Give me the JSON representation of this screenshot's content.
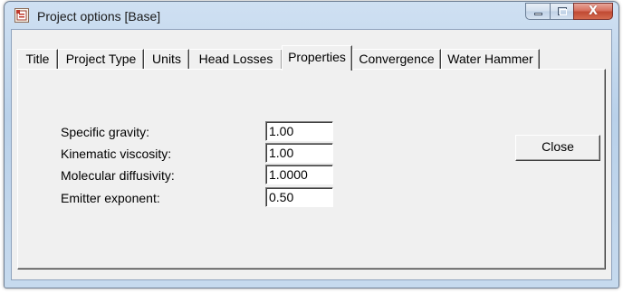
{
  "window": {
    "title": "Project options [Base]",
    "icon": "project-options-app-icon",
    "caption_buttons": {
      "minimize_icon": "minimize-icon",
      "maximize_icon": "maximize-icon",
      "close_glyph": "X"
    }
  },
  "tabs": [
    {
      "label": "Title"
    },
    {
      "label": "Project Type"
    },
    {
      "label": "Units"
    },
    {
      "label": "Head Losses"
    },
    {
      "label": "Properties",
      "active": true
    },
    {
      "label": "Convergence"
    },
    {
      "label": "Water Hammer"
    }
  ],
  "properties": {
    "fields": [
      {
        "label": "Specific gravity:",
        "value": "1.00"
      },
      {
        "label": "Kinematic viscosity:",
        "value": "1.00"
      },
      {
        "label": "Molecular diffusivity:",
        "value": "1.0000"
      },
      {
        "label": "Emitter exponent:",
        "value": "0.50"
      }
    ]
  },
  "buttons": {
    "close_label": "Close"
  },
  "colors": {
    "dialog_face": "#f0f0f0",
    "title_gradient": "#c6daee",
    "close_red": "#c04a33"
  }
}
